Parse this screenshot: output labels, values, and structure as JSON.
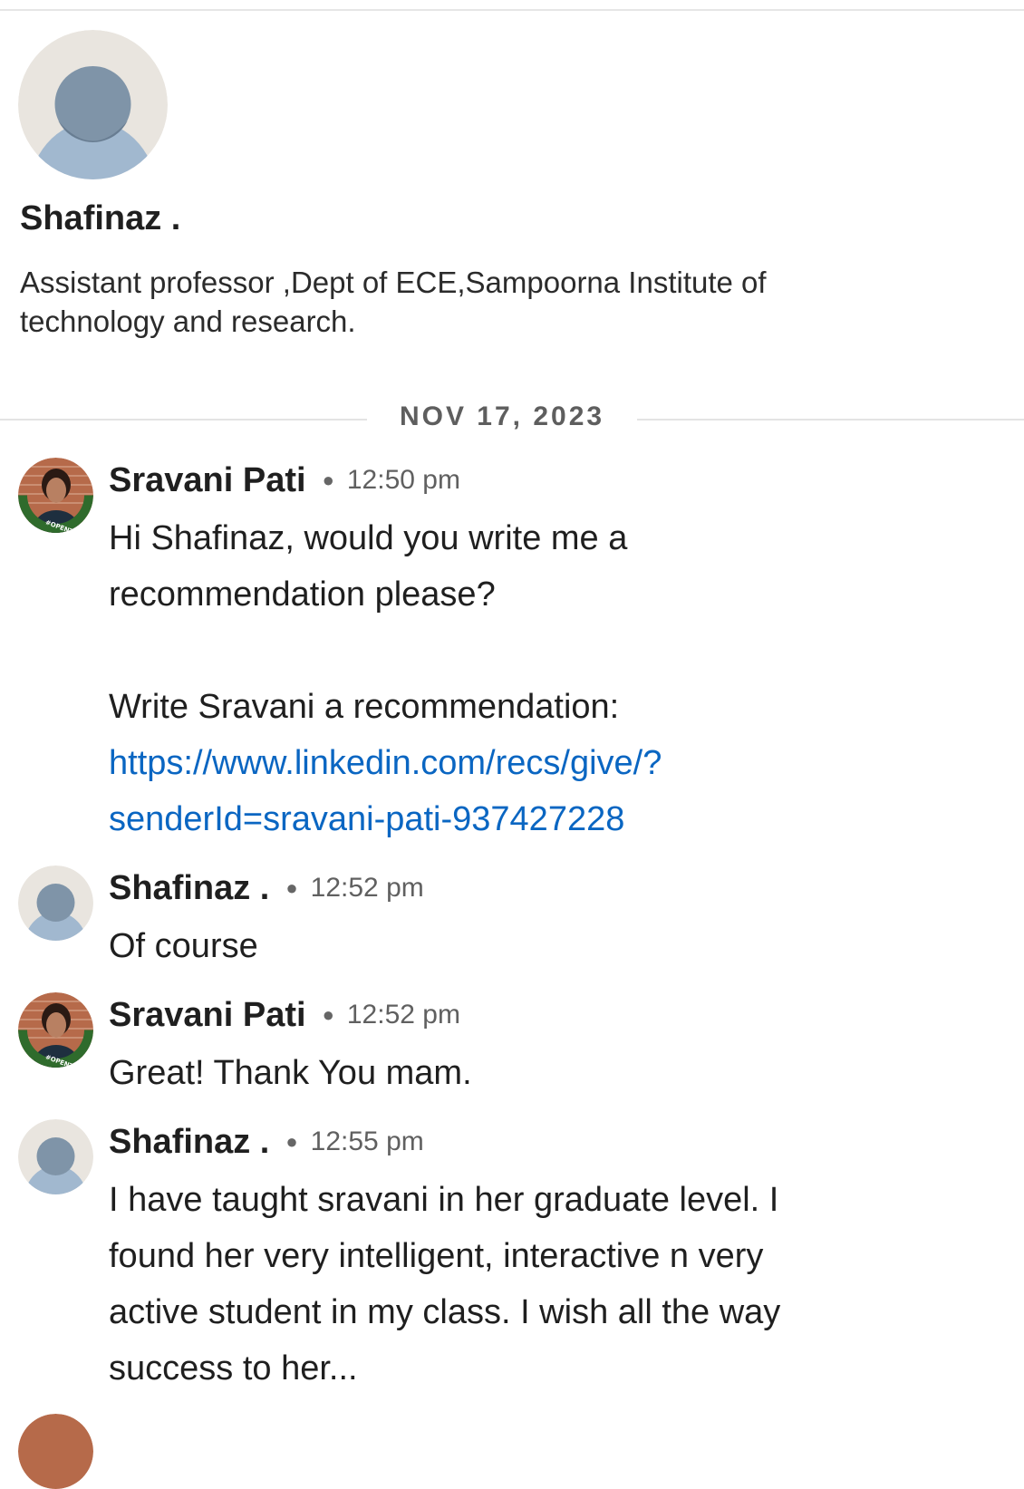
{
  "profile": {
    "name": "Shafinaz .",
    "headline_line1": "Assistant professor ,Dept of ECE,Sampoorna Institute of",
    "headline_line2": "technology and research."
  },
  "conversation": {
    "date_divider": "NOV 17, 2023",
    "messages": [
      {
        "sender": "Sravani Pati",
        "time": "12:50 pm",
        "line1": "Hi Shafinaz, would you write me a",
        "line2": "recommendation please?",
        "line3": "Write Sravani a recommendation:",
        "link_line1": "https://www.linkedin.com/recs/give/?",
        "link_line2": "senderId=sravani-pati-937427228"
      },
      {
        "sender": "Shafinaz .",
        "time": "12:52 pm",
        "line1": "Of course"
      },
      {
        "sender": "Sravani Pati",
        "time": "12:52 pm",
        "line1": "Great! Thank You mam."
      },
      {
        "sender": "Shafinaz .",
        "time": "12:55 pm",
        "line1": "I have taught sravani in her graduate level. I",
        "line2": "found her very intelligent, interactive n very",
        "line3": "active student in my class. I wish all the way",
        "line4": "success to her..."
      }
    ]
  },
  "badges": {
    "open_to_work": "#OPENTOWORK"
  },
  "colors": {
    "link": "#0a66c2",
    "avatar_bg": "#e9e5df",
    "avatar_head": "#7f94a8",
    "avatar_body": "#a1b8cf",
    "open_to_work_green": "#2f6b2c"
  },
  "icons": {
    "profile_placeholder": "person-placeholder-icon",
    "sender_photo": "profile-photo-icon"
  }
}
